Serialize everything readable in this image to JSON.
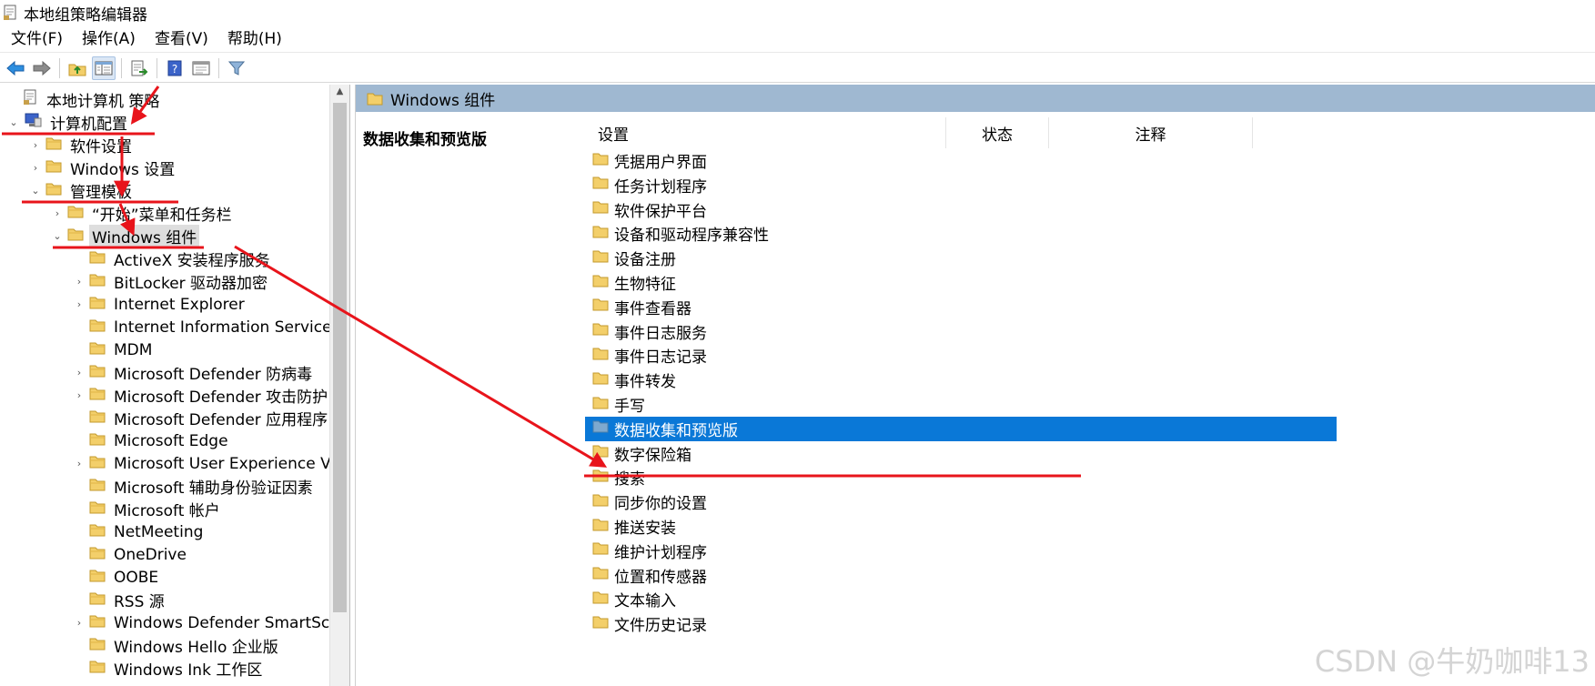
{
  "window": {
    "title": "本地组策略编辑器"
  },
  "menubar": {
    "items": [
      "文件(F)",
      "操作(A)",
      "查看(V)",
      "帮助(H)"
    ]
  },
  "toolbar": {
    "buttons": [
      "back-arrow-icon",
      "forward-arrow-icon",
      "up-folder-icon",
      "show-hide-tree-icon",
      "export-list-icon",
      "help-icon",
      "properties-icon",
      "filter-icon"
    ]
  },
  "tree": {
    "nodes": [
      {
        "label": "本地计算机 策略",
        "level": 0,
        "expander": "",
        "icon": "policy-doc-icon"
      },
      {
        "label": "计算机配置",
        "level": 0,
        "expander": "⌄",
        "icon": "computer-icon"
      },
      {
        "label": "软件设置",
        "level": 1,
        "expander": "›",
        "icon": "folder-icon"
      },
      {
        "label": "Windows 设置",
        "level": 1,
        "expander": "›",
        "icon": "folder-icon"
      },
      {
        "label": "管理模板",
        "level": 1,
        "expander": "⌄",
        "icon": "folder-icon"
      },
      {
        "label": "“开始”菜单和任务栏",
        "level": 2,
        "expander": "›",
        "icon": "folder-icon"
      },
      {
        "label": "Windows 组件",
        "level": 2,
        "expander": "⌄",
        "icon": "folder-icon",
        "selected": true
      },
      {
        "label": "ActiveX 安装程序服务",
        "level": 3,
        "expander": "",
        "icon": "folder-icon"
      },
      {
        "label": "BitLocker 驱动器加密",
        "level": 3,
        "expander": "›",
        "icon": "folder-icon"
      },
      {
        "label": "Internet Explorer",
        "level": 3,
        "expander": "›",
        "icon": "folder-icon"
      },
      {
        "label": "Internet Information Services",
        "level": 3,
        "expander": "",
        "icon": "folder-icon"
      },
      {
        "label": "MDM",
        "level": 3,
        "expander": "",
        "icon": "folder-icon"
      },
      {
        "label": "Microsoft Defender 防病毒",
        "level": 3,
        "expander": "›",
        "icon": "folder-icon"
      },
      {
        "label": "Microsoft Defender 攻击防护",
        "level": 3,
        "expander": "›",
        "icon": "folder-icon"
      },
      {
        "label": "Microsoft Defender 应用程序",
        "level": 3,
        "expander": "",
        "icon": "folder-icon"
      },
      {
        "label": "Microsoft Edge",
        "level": 3,
        "expander": "",
        "icon": "folder-icon"
      },
      {
        "label": "Microsoft User Experience Vir",
        "level": 3,
        "expander": "›",
        "icon": "folder-icon"
      },
      {
        "label": "Microsoft 辅助身份验证因素",
        "level": 3,
        "expander": "",
        "icon": "folder-icon"
      },
      {
        "label": "Microsoft 帐户",
        "level": 3,
        "expander": "",
        "icon": "folder-icon"
      },
      {
        "label": "NetMeeting",
        "level": 3,
        "expander": "",
        "icon": "folder-icon"
      },
      {
        "label": "OneDrive",
        "level": 3,
        "expander": "",
        "icon": "folder-icon"
      },
      {
        "label": "OOBE",
        "level": 3,
        "expander": "",
        "icon": "folder-icon"
      },
      {
        "label": "RSS 源",
        "level": 3,
        "expander": "",
        "icon": "folder-icon"
      },
      {
        "label": "Windows Defender SmartScr",
        "level": 3,
        "expander": "›",
        "icon": "folder-icon"
      },
      {
        "label": "Windows Hello 企业版",
        "level": 3,
        "expander": "",
        "icon": "folder-icon"
      },
      {
        "label": "Windows Ink 工作区",
        "level": 3,
        "expander": "",
        "icon": "folder-icon"
      }
    ]
  },
  "right_pane": {
    "header_title": "Windows 组件",
    "section_title": "数据收集和预览版",
    "columns": [
      "设置",
      "状态",
      "注释"
    ],
    "rows": [
      {
        "label": "凭据用户界面"
      },
      {
        "label": "任务计划程序"
      },
      {
        "label": "软件保护平台"
      },
      {
        "label": "设备和驱动程序兼容性"
      },
      {
        "label": "设备注册"
      },
      {
        "label": "生物特征"
      },
      {
        "label": "事件查看器"
      },
      {
        "label": "事件日志服务"
      },
      {
        "label": "事件日志记录"
      },
      {
        "label": "事件转发"
      },
      {
        "label": "手写"
      },
      {
        "label": "数据收集和预览版",
        "selected": true
      },
      {
        "label": "数字保险箱"
      },
      {
        "label": "搜索"
      },
      {
        "label": "同步你的设置"
      },
      {
        "label": "推送安装"
      },
      {
        "label": "维护计划程序"
      },
      {
        "label": "位置和传感器"
      },
      {
        "label": "文本输入"
      },
      {
        "label": "文件历史记录"
      }
    ]
  },
  "watermark": "CSDN @牛奶咖啡13",
  "colors": {
    "selection": "#0a78d7",
    "header_band": "#9fb8d1",
    "annotation": "#e8141b",
    "folder": "#f3cf6a"
  }
}
